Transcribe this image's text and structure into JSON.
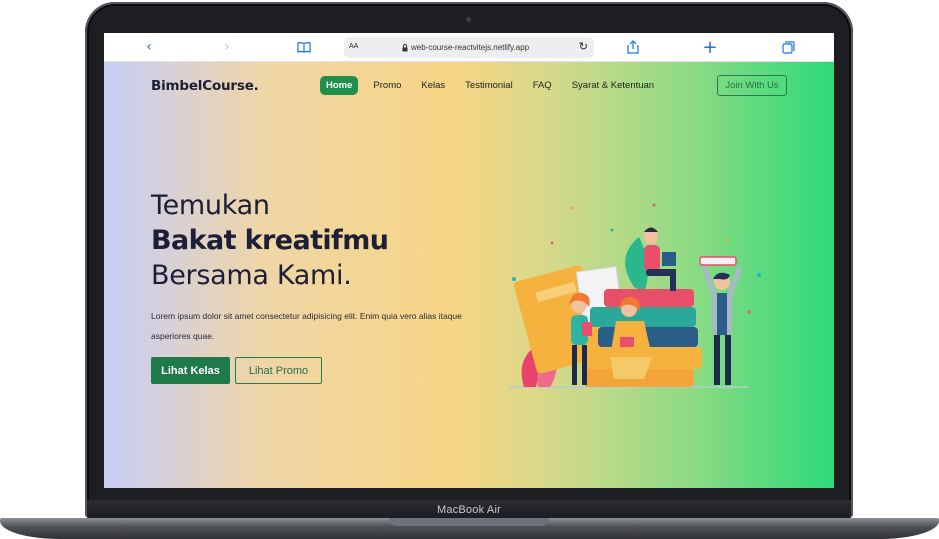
{
  "browser": {
    "address_small_text": "AA",
    "url": "web-course-reactvitejs.netlify.app",
    "icons": [
      "back-icon",
      "forward-icon",
      "book-icon",
      "lock-icon",
      "reload-icon",
      "share-icon",
      "new-tab-icon",
      "tabs-icon"
    ]
  },
  "navbar": {
    "brand": "BimbelCourse.",
    "items": [
      {
        "label": "Home",
        "active": true
      },
      {
        "label": "Promo"
      },
      {
        "label": "Kelas"
      },
      {
        "label": "Testimonial"
      },
      {
        "label": "FAQ"
      },
      {
        "label": "Syarat & Ketentuan"
      }
    ],
    "cta": "Join With Us"
  },
  "hero": {
    "line1": "Temukan",
    "line2": "Bakat kreatifmu",
    "line3": "Bersama Kami.",
    "description": "Lorem ipsum dolor sit amet consectetur adipisicing elit. Enim quia vero alias itaque asperiores quae.",
    "primary_button": "Lihat Kelas",
    "secondary_button": "Lihat Promo"
  },
  "device": {
    "label": "MacBook Air"
  },
  "colors": {
    "brand_green": "#1f8f4a",
    "text_dark": "#1d1f36",
    "gradient_start": "#c7cdf6",
    "gradient_mid": "#f7d585",
    "gradient_end": "#2dd97a"
  }
}
